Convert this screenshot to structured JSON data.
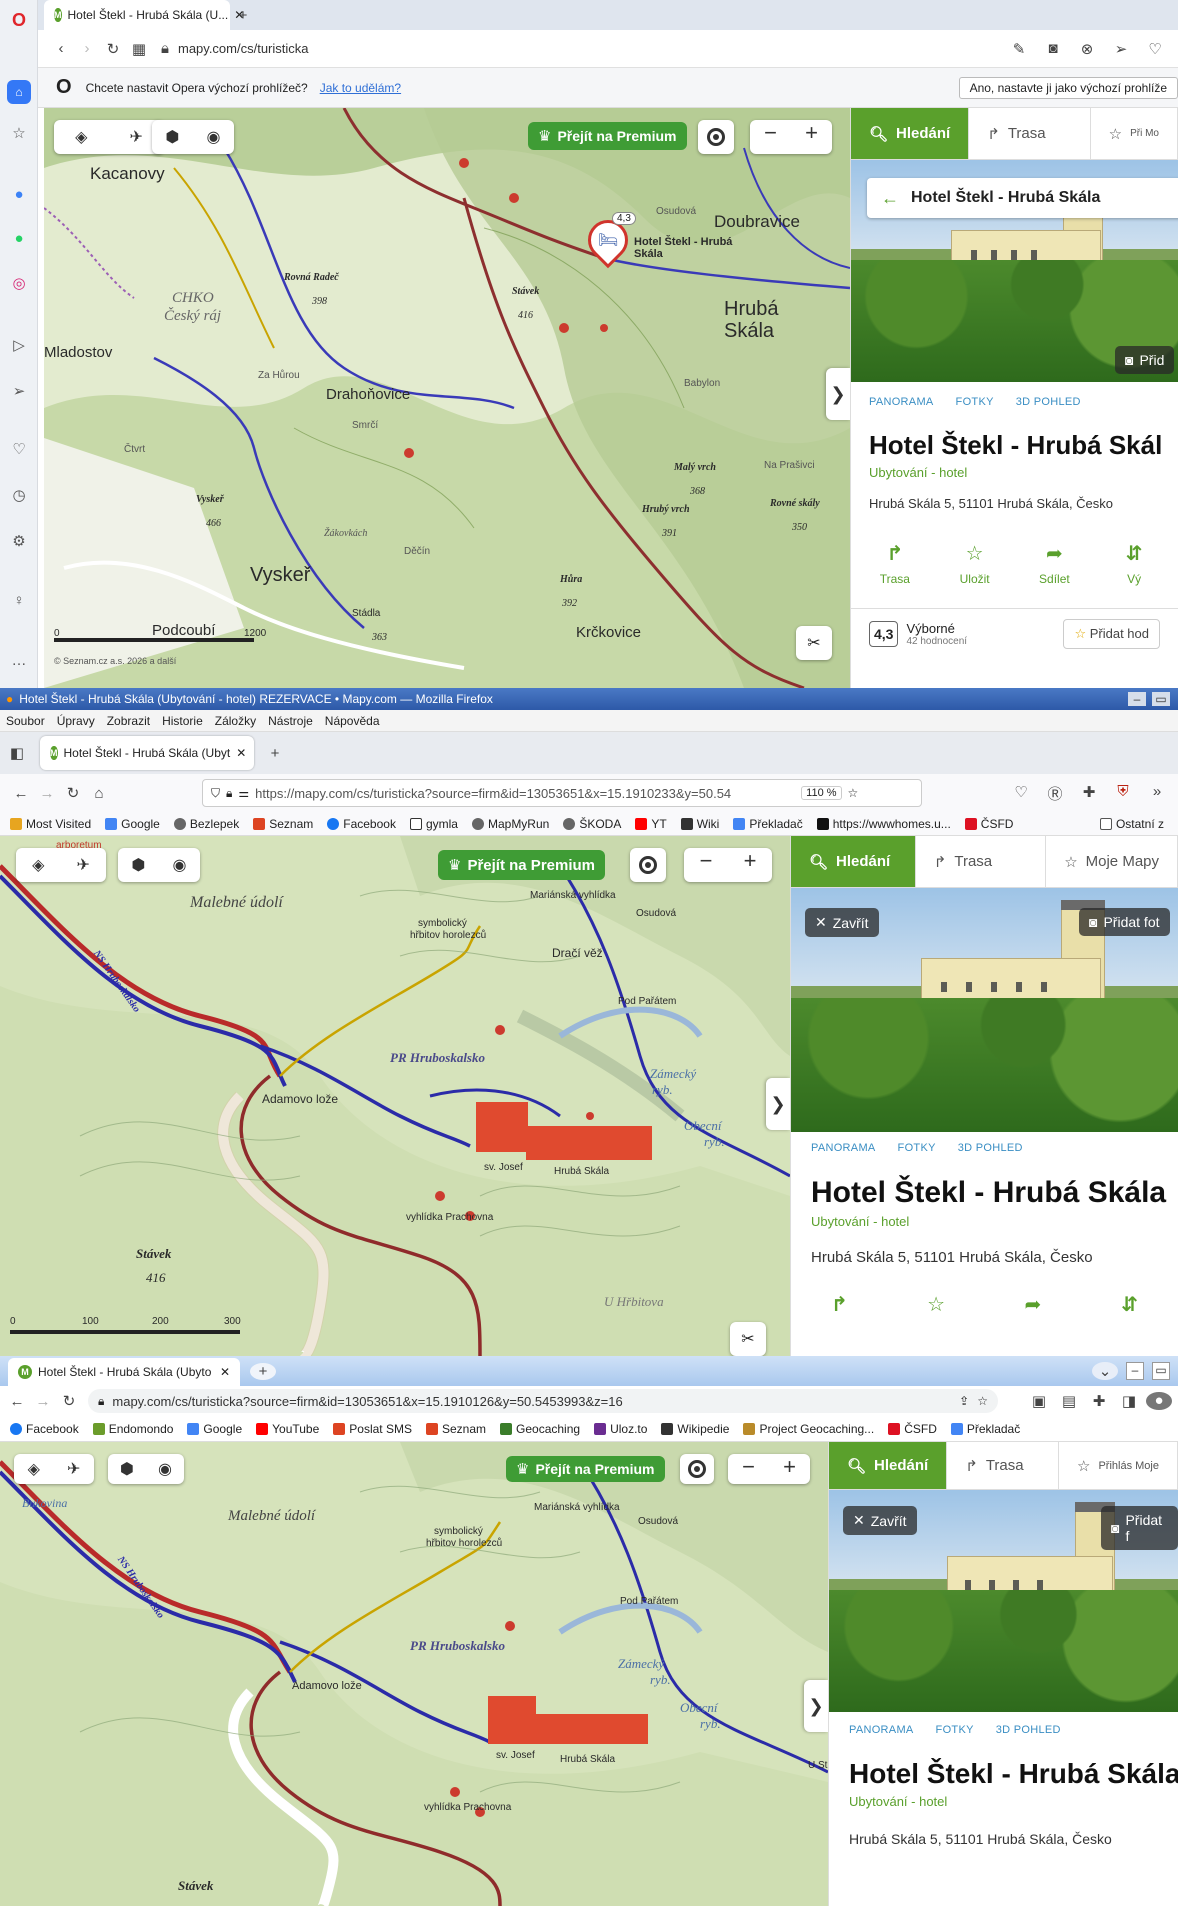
{
  "s1": {
    "tab_title": "Hotel Štekl - Hrubá Skála (U...",
    "url": "mapy.com/cs/turisticka",
    "default_prompt": "Chcete nastavit Opera výchozí prohlížeč?",
    "default_link": "Jak to udělám?",
    "default_button": "Ano, nastavte ji jako výchozí prohlíže",
    "premium": "Přejít na Premium",
    "panel_back_title": "Hotel Štekl - Hrubá Skála",
    "photo_add": "Přid",
    "tabs": {
      "search": "Hledání",
      "route": "Trasa",
      "third": "Při Mo"
    },
    "cats": [
      "PANORAMA",
      "FOTKY",
      "3D POHLED"
    ],
    "title": "Hotel Štekl - Hrubá Skál",
    "subtitle": "Ubytování - hotel",
    "address": "Hrubá Skála 5, 51101 Hrubá Skála, Česko",
    "actions": [
      "Trasa",
      "Uložit",
      "Sdílet",
      "Vý"
    ],
    "rating_value": "4,3",
    "rating_label": "Výborné",
    "rating_count": "42 hodnocení",
    "add_review": "Přidat hod",
    "map_labels": {
      "kacanovy": "Kacanovy",
      "doubravice": "Doubravice",
      "hruba": "Hrubá",
      "skala": "Skála",
      "drahonovice": "Drahoňovice",
      "vysker": "Vyskeř",
      "krckovice": "Krčkovice",
      "podcobi": "Podcoubí",
      "mladostov": "Mladostov",
      "chko1": "CHKO",
      "chko2": "Český ráj",
      "rovna": "Rovná Radeč",
      "rovna_h": "398",
      "stavek": "Stávek",
      "stavek_h": "416",
      "maly": "Malý vrch",
      "maly_h": "368",
      "hruby": "Hrubý vrch",
      "hruby_h": "391",
      "hura": "Hůra",
      "hura_h": "392",
      "rovne": "Rovné skály",
      "rovne_h": "350",
      "vysker_peak": "Vyskeř",
      "vysker_h": "466",
      "smrci": "Smrčí",
      "babylon": "Babylon",
      "hotel": "Hotel Štekl - Hrubá Skála",
      "badge": "4,3",
      "zakovka": "Žákovkách",
      "decin": "Děčín",
      "stadla": "Stádla",
      "stadla_h": "363",
      "ctvrt": "Čtvrt",
      "zahuru": "Za Hůrou",
      "osudova": "Osudová",
      "naprasivci": "Na Prašivci",
      "scale0": "0",
      "scale1": "1200",
      "copy": "© Seznam.cz a.s. 2026 a další"
    }
  },
  "s2": {
    "window_title": "Hotel Štekl - Hrubá Skála (Ubytování - hotel) REZERVACE • Mapy.com — Mozilla Firefox",
    "menu": [
      "Soubor",
      "Úpravy",
      "Zobrazit",
      "Historie",
      "Záložky",
      "Nástroje",
      "Nápověda"
    ],
    "tab_title": "Hotel Štekl - Hrubá Skála (Ubyt",
    "url": "https://mapy.com/cs/turisticka?source=firm&id=13053651&x=15.1910233&y=50.54",
    "zoom": "110 %",
    "bookmarks": [
      "Most Visited",
      "Google",
      "Bezlepek",
      "Seznam",
      "Facebook",
      "gymla",
      "MapMyRun",
      "ŠKODA",
      "YT",
      "Wiki",
      "Překladač",
      "https://wwwhomes.u...",
      "ČSFD",
      "Ostatní z"
    ],
    "premium": "Přejít na Premium",
    "tabs": {
      "search": "Hledání",
      "route": "Trasa",
      "third": "Moje Mapy"
    },
    "close": "Zavřít",
    "photo_add": "Přidat fot",
    "cats": [
      "PANORAMA",
      "FOTKY",
      "3D POHLED"
    ],
    "title": "Hotel Štekl - Hrubá Skála",
    "subtitle": "Ubytování - hotel",
    "address": "Hrubá Skála 5, 51101 Hrubá Skála, Česko",
    "map_labels": {
      "malebne": "Malebné údolí",
      "symb1": "symbolický",
      "symb2": "hřbitov horolezců",
      "marian": "Mariánská vyhlídka",
      "osudova": "Osudová",
      "draci": "Dračí věž",
      "podpar": "Pod Pařátem",
      "zamecky": "Zámecký",
      "ryb1": "ryb.",
      "obecni": "Obecní",
      "ryb2": "ryb.",
      "pr": "PR Hruboskalsko",
      "adamovo": "Adamovo lože",
      "stavek": "Stávek",
      "stavek_h": "416",
      "vyhlidka": "vyhlídka Prachovna",
      "hrubaskala": "Hrubá Skála",
      "svjosef": "sv. Josef",
      "uhrbitova": "U Hřbitova",
      "arboretum": "arboretum",
      "ns": "NS Hruboskalsko",
      "scale": [
        "0",
        "100",
        "200",
        "300"
      ]
    }
  },
  "s3": {
    "tab_title": "Hotel Štekl - Hrubá Skála (Ubyto",
    "url": "mapy.com/cs/turisticka?source=firm&id=13053651&x=15.1910126&y=50.5453993&z=16",
    "bookmarks": [
      "Facebook",
      "Endomondo",
      "Google",
      "YouTube",
      "Poslat SMS",
      "Seznam",
      "Geocaching",
      "Uloz.to",
      "Wikipedie",
      "Project Geocaching...",
      "ČSFD",
      "Překladač"
    ],
    "premium": "Přejít na Premium",
    "tabs": {
      "search": "Hledání",
      "route": "Trasa",
      "third": "Přihlás Moje"
    },
    "close": "Zavřít",
    "photo_add": "Přidat f",
    "cats": [
      "PANORAMA",
      "FOTKY",
      "3D POHLED"
    ],
    "title": "Hotel Štekl - Hrubá Skála",
    "subtitle": "Ubytování - hotel",
    "address": "Hrubá Skála 5, 51101 Hrubá Skála, Česko",
    "map_labels": {
      "bukovina": "Bukovina",
      "malebne": "Malebné údolí",
      "symb1": "symbolický",
      "symb2": "hřbitov horolezců",
      "marian": "Mariánská vyhlídka",
      "osudova": "Osudová",
      "podpar": "Pod Pařátem",
      "zamecky": "Zámecký",
      "ryb1": "ryb.",
      "obecni": "Obecní",
      "ryb2": "ryb.",
      "pr": "PR Hruboskalsko",
      "adamovo": "Adamovo lože",
      "stavek": "Stávek",
      "vyhlidka": "vyhlídka Prachovna",
      "hrubaskala": "Hrubá Skála",
      "svjosef": "sv. Josef",
      "ust": "U St",
      "ns": "NS Hruboskalsko"
    }
  }
}
